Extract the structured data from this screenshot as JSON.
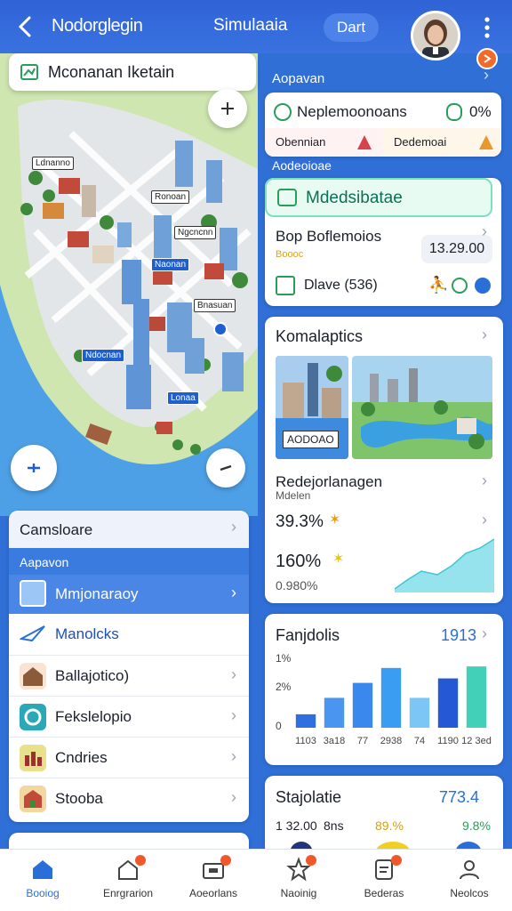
{
  "topbar": {
    "title": "Nodorglegin",
    "center": "Simulaaia",
    "pill": "Dart",
    "notif_badge": ""
  },
  "map": {
    "search_text": "Mconanan Iketain",
    "labels": [
      "Ldnanno",
      "Ronoan",
      "Ngcncnn",
      "Naonan",
      "Bnasuan",
      "Ndocnan",
      "Lonaa"
    ]
  },
  "right": {
    "section1": "Aopavan",
    "section2": "Aodeoioae",
    "stat": {
      "title": "Neplemoonoans",
      "pct": "0%",
      "left": "Obennian",
      "right": "Dedemoai"
    },
    "model": {
      "head": "Mdedsibatae",
      "line1": "Bop Boflemoios",
      "sub": "Boooc",
      "value": "13.29.00",
      "line2": "Dlave (536)"
    },
    "analytics": {
      "title": "Komalaptics",
      "img_label": "AODOAO",
      "subtitle": "Redejorlanagen",
      "subtitle2": "Mdelen",
      "v1": "39.3%",
      "v2": "160%",
      "v3": "0.980%"
    },
    "revenue": {
      "title": "Fanjdolis",
      "value": "1913",
      "y_ticks": [
        "1%",
        "2%",
        "0"
      ],
      "x_ticks": [
        "1103",
        "3a18",
        "77",
        "2938",
        "74",
        "1190",
        "12 3ed"
      ]
    },
    "sim": {
      "title": "Stajolatie",
      "value": "773.4",
      "l1": "1 32.00",
      "l2": "8ns",
      "p1": "89.%",
      "p2": "9.8%"
    }
  },
  "left_list": {
    "head": "Camsloare",
    "sub_label": "Aapavon",
    "selected": "Mmjonaraoy",
    "items": [
      "Manolcks",
      "Ballajotico)",
      "Fekslelopio",
      "Cndries",
      "Stooba"
    ]
  },
  "nav": {
    "items": [
      "Booiog",
      "Enrgrarion",
      "Aoeorlans",
      "Naoinig",
      "Bederas",
      "Neolcos"
    ]
  },
  "chart_data": {
    "type": "bar",
    "title": "Fanjdolis",
    "categories": [
      "1103",
      "3a18",
      "77",
      "2938",
      "74",
      "1190",
      "12 3ed"
    ],
    "values": [
      18,
      40,
      60,
      80,
      40,
      66,
      82
    ],
    "ylim": [
      0,
      100
    ],
    "colors": [
      "#2f6fe0",
      "#4a95ef",
      "#3a88ee",
      "#3b9df2",
      "#7cc6f6",
      "#2458d4",
      "#42d0b8"
    ]
  }
}
